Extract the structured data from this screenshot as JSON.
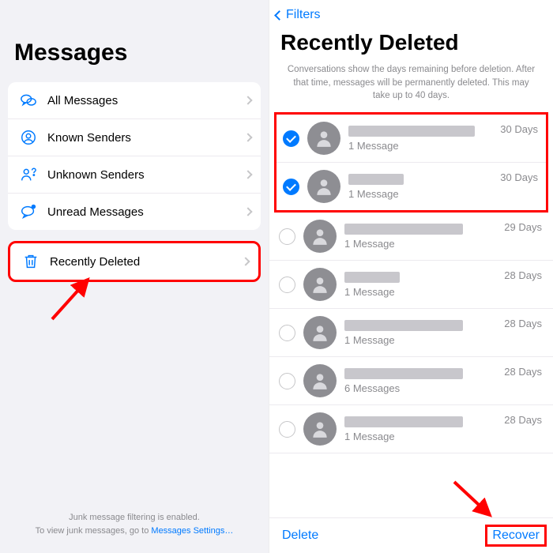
{
  "left": {
    "title": "Messages",
    "items": [
      {
        "label": "All Messages",
        "icon": "bubbles"
      },
      {
        "label": "Known Senders",
        "icon": "person-circle"
      },
      {
        "label": "Unknown Senders",
        "icon": "person-question"
      },
      {
        "label": "Unread Messages",
        "icon": "bubble-dot"
      }
    ],
    "deleted_label": "Recently Deleted",
    "footer_line1": "Junk message filtering is enabled.",
    "footer_line2_a": "To view junk messages, go to ",
    "footer_line2_link": "Messages Settings…"
  },
  "right": {
    "back_label": "Filters",
    "title": "Recently Deleted",
    "note": "Conversations show the days remaining before deletion. After that time, messages will be permanently deleted. This may take up to 40 days.",
    "conversations": [
      {
        "selected": true,
        "count_label": "1 Message",
        "days_label": "30 Days",
        "name_w": 160
      },
      {
        "selected": true,
        "count_label": "1 Message",
        "days_label": "30 Days",
        "name_w": 70
      },
      {
        "selected": false,
        "count_label": "1 Message",
        "days_label": "29 Days",
        "name_w": 150
      },
      {
        "selected": false,
        "count_label": "1 Message",
        "days_label": "28 Days",
        "name_w": 70
      },
      {
        "selected": false,
        "count_label": "1 Message",
        "days_label": "28 Days",
        "name_w": 150
      },
      {
        "selected": false,
        "count_label": "6 Messages",
        "days_label": "28 Days",
        "name_w": 150
      },
      {
        "selected": false,
        "count_label": "1 Message",
        "days_label": "28 Days",
        "name_w": 150
      }
    ],
    "delete_label": "Delete",
    "recover_label": "Recover"
  }
}
